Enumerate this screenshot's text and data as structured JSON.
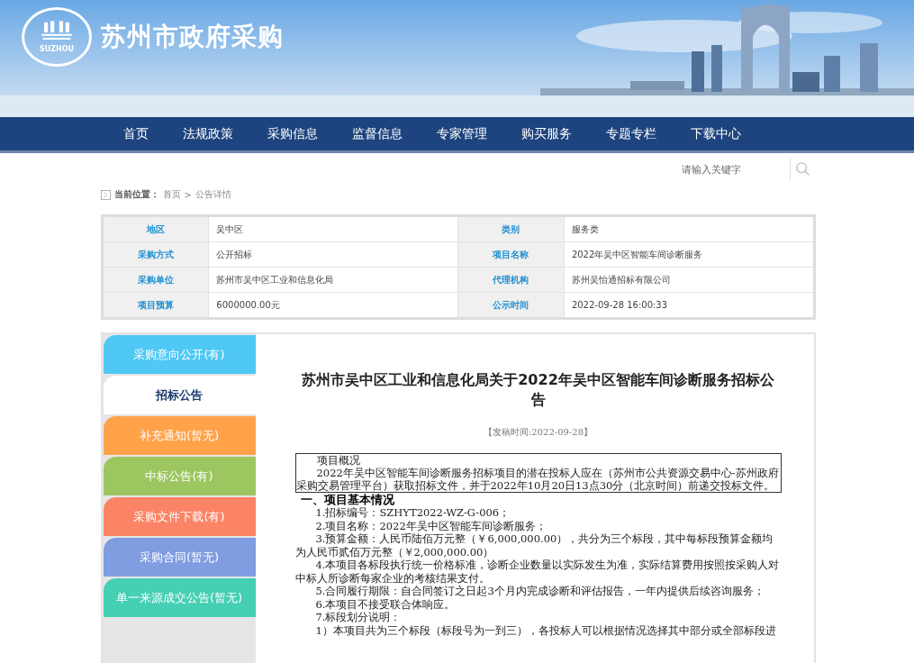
{
  "header": {
    "logo_text": "SUZHOU",
    "site_title": "苏州市政府采购"
  },
  "nav": [
    "首页",
    "法规政策",
    "采购信息",
    "监督信息",
    "专家管理",
    "购买服务",
    "专题专栏",
    "下载中心"
  ],
  "search": {
    "placeholder": "请输入关键字"
  },
  "breadcrumb": {
    "label": "当前位置：",
    "items": [
      "首页",
      "公告详情"
    ],
    "separator": ">"
  },
  "info_table": [
    {
      "label": "地区",
      "value": "吴中区",
      "label2": "类别",
      "value2": "服务类"
    },
    {
      "label": "采购方式",
      "value": "公开招标",
      "label2": "项目名称",
      "value2": "2022年吴中区智能车间诊断服务"
    },
    {
      "label": "采购单位",
      "value": "苏州市吴中区工业和信息化局",
      "label2": "代理机构",
      "value2": "苏州吴怡通招标有限公司"
    },
    {
      "label": "项目预算",
      "value": "6000000.00元",
      "label2": "公示时间",
      "value2": "2022-09-28 16:00:33"
    }
  ],
  "sidebar": [
    {
      "label": "采购意向公开(有)",
      "color": "#4fc8f5",
      "selected": false
    },
    {
      "label": "招标公告",
      "selected": true
    },
    {
      "label": "补充通知(暂无)",
      "color": "#ffa24a",
      "selected": false
    },
    {
      "label": "中标公告(有)",
      "color": "#9cc660",
      "selected": false
    },
    {
      "label": "采购文件下载(有)",
      "color": "#fc8466",
      "selected": false
    },
    {
      "label": "采购合同(暂无)",
      "color": "#7f9de0",
      "selected": false
    },
    {
      "label": "单一来源成交公告(暂无)",
      "color": "#45cfb3",
      "selected": false
    }
  ],
  "article": {
    "title": "苏州市吴中区工业和信息化局关于2022年吴中区智能车间诊断服务招标公告",
    "date": "【发稿时间:2022-09-28】",
    "summary_heading": "项目概况",
    "summary_text": "2022年吴中区智能车间诊断服务招标项目的潜在投标人应在（苏州市公共资源交易中心-苏州政府采购交易管理平台）获取招标文件，并于2022年10月20日13点30分（北京时间）前递交投标文件。",
    "section_heading": "一、项目基本情况",
    "items": [
      "1.招标编号：SZHYT2022-WZ-G-006；",
      "2.项目名称：2022年吴中区智能车间诊断服务；",
      "3.预算金额：人民币陆佰万元整（￥6,000,000.00），共分为三个标段，其中每标段预算金额均为人民币贰佰万元整（￥2,000,000.00）",
      "4.本项目各标段执行统一价格标准，诊断企业数量以实际发生为准，实际结算费用按照按采购人对中标人所诊断每家企业的考核结果支付。",
      "5.合同履行期限：自合同签订之日起3个月内完成诊断和评估报告，一年内提供后续咨询服务；",
      "6.本项目不接受联合体响应。",
      "7.标段划分说明：",
      "1）本项目共为三个标段（标段号为一到三），各投标人可以根据情况选择其中部分或全部标段进"
    ]
  }
}
